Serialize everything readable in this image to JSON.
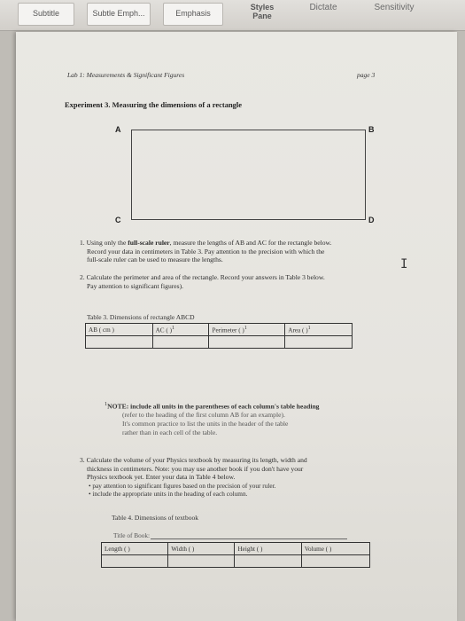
{
  "ribbon": {
    "subtitle": "Subtitle",
    "subtle_emph": "Subtle Emph...",
    "emphasis": "Emphasis",
    "styles_pane": "Styles\nPane",
    "styles_line1": "Styles",
    "styles_line2": "Pane",
    "dictate": "Dictate",
    "sensitivity": "Sensitivity"
  },
  "page": {
    "header_left": "Lab 1: Measurements & Significant Figures",
    "header_right": "page 3",
    "experiment_label": "Experiment 3.",
    "experiment_title": "Measuring the dimensions of a rectangle",
    "corners": {
      "a": "A",
      "b": "B",
      "c": "C",
      "d": "D"
    },
    "item1": {
      "line1_pre": "1. Using only the ",
      "line1_bold": "full-scale ruler",
      "line1_post": ", measure the lengths of AB and AC for the rectangle below.",
      "line2": "Record your data in centimeters in Table 3. Pay attention to the precision with which the",
      "line3": "full-scale ruler can be used to measure the lengths."
    },
    "item2": {
      "line1": "2. Calculate the perimeter and area of the rectangle. Record your answers in Table 3 below.",
      "line2": "Pay attention to significant figures)."
    },
    "table3": {
      "caption": "Table 3. Dimensions of rectangle ABCD",
      "headers": [
        "AB ( cm )",
        "AC (      )",
        "Perimeter (       )",
        "Area (       )"
      ],
      "superscripts": [
        "",
        "1",
        "1",
        "1"
      ]
    },
    "note": {
      "sup": "1",
      "label": "NOTE",
      "line1_rest": ": include all units in the parentheses of each column's table heading",
      "line2": "(refer to the heading of the first column AB for an example).",
      "line3": "It's common practice to list the units in the header of the table",
      "line4": "rather than in each cell of the table."
    },
    "item3": {
      "line1": "3. Calculate the volume of your Physics textbook by measuring its length, width and",
      "line2": "thickness in centimeters. Note: you may use another book if you don't have your",
      "line3": "Physics textbook yet. Enter your data in Table 4 below.",
      "bullet1": "pay attention to significant figures based on the precision of your ruler.",
      "bullet2": "include the appropriate units in the heading of each column."
    },
    "table4": {
      "caption": "Table 4. Dimensions of textbook",
      "title_label": "Title of Book:",
      "headers": [
        "Length (        )",
        "Width (          )",
        "Height (         )",
        "Volume (          )"
      ]
    }
  }
}
